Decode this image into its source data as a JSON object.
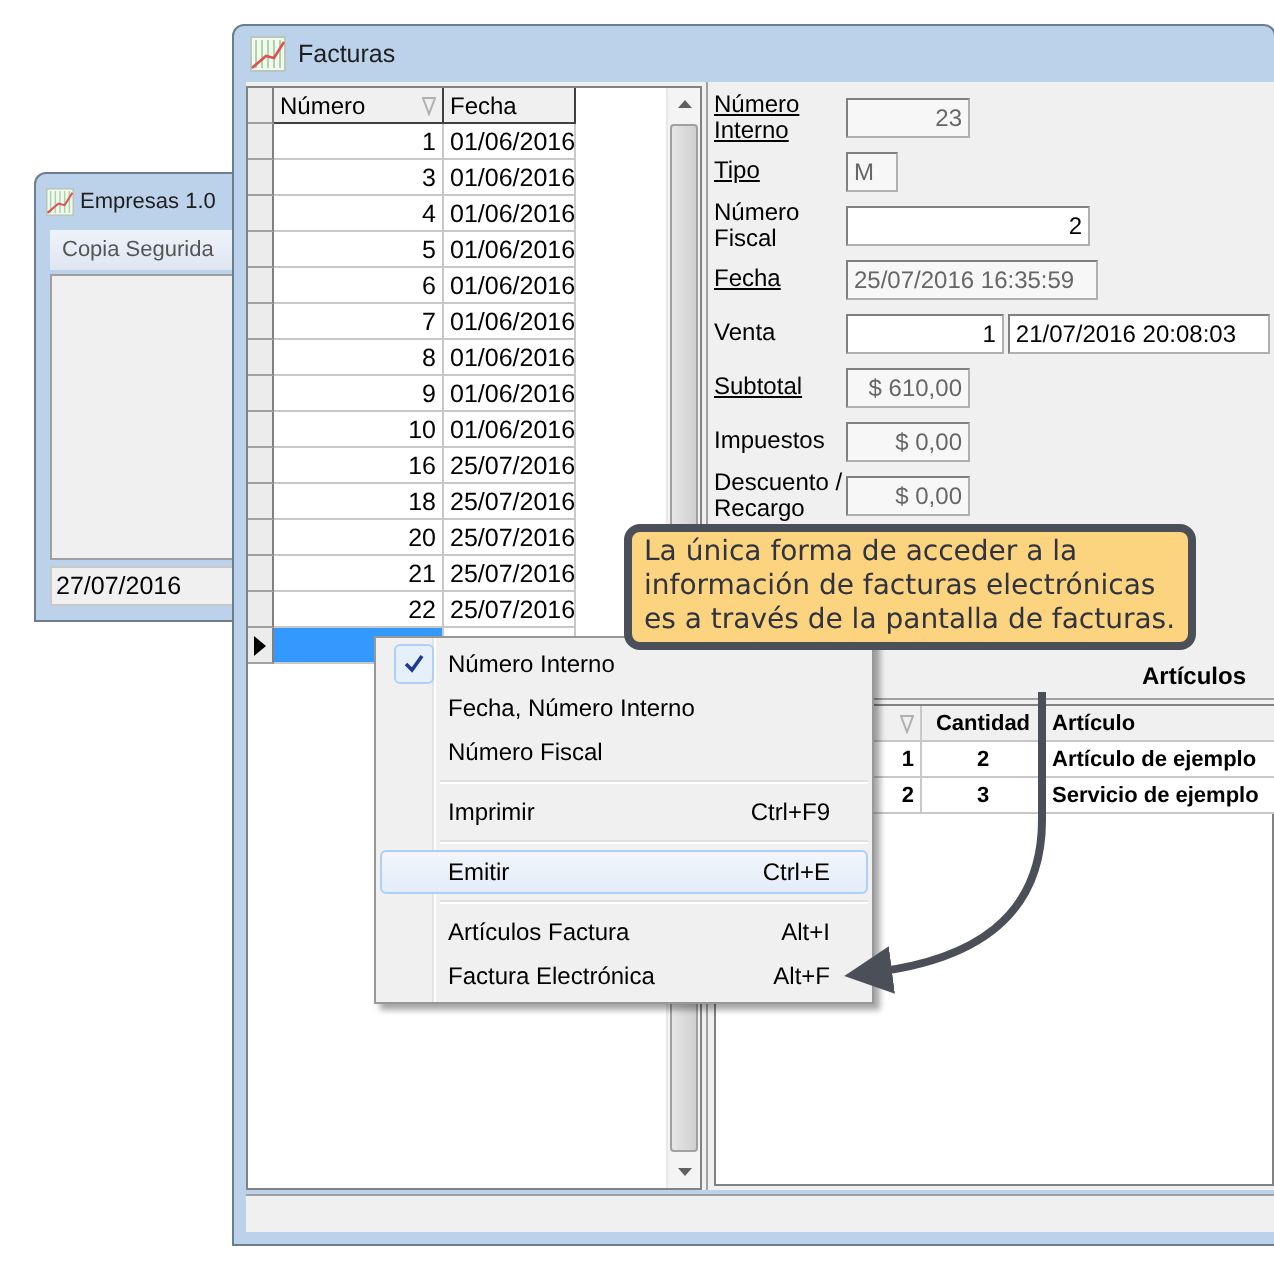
{
  "background_window": {
    "title": "Empresas 1.0",
    "menu": "Copia Segurida",
    "status": "27/07/2016"
  },
  "window": {
    "title": "Facturas"
  },
  "list": {
    "columns": [
      "Número",
      "Fecha"
    ],
    "rows": [
      {
        "numero": "1",
        "fecha": "01/06/2016",
        "selected": false
      },
      {
        "numero": "3",
        "fecha": "01/06/2016",
        "selected": false
      },
      {
        "numero": "4",
        "fecha": "01/06/2016",
        "selected": false
      },
      {
        "numero": "5",
        "fecha": "01/06/2016",
        "selected": false
      },
      {
        "numero": "6",
        "fecha": "01/06/2016",
        "selected": false
      },
      {
        "numero": "7",
        "fecha": "01/06/2016",
        "selected": false
      },
      {
        "numero": "8",
        "fecha": "01/06/2016",
        "selected": false
      },
      {
        "numero": "9",
        "fecha": "01/06/2016",
        "selected": false
      },
      {
        "numero": "10",
        "fecha": "01/06/2016",
        "selected": false
      },
      {
        "numero": "16",
        "fecha": "25/07/2016",
        "selected": false
      },
      {
        "numero": "18",
        "fecha": "25/07/2016",
        "selected": false
      },
      {
        "numero": "20",
        "fecha": "25/07/2016",
        "selected": false
      },
      {
        "numero": "21",
        "fecha": "25/07/2016",
        "selected": false
      },
      {
        "numero": "22",
        "fecha": "25/07/2016",
        "selected": false
      },
      {
        "selected": true
      }
    ]
  },
  "form": [
    {
      "kind": "number",
      "label": "Número Interno",
      "value": "23",
      "underlined": true,
      "disabled": true
    },
    {
      "kind": "code",
      "label": "Tipo",
      "value": "M",
      "underlined": true,
      "disabled": true
    },
    {
      "kind": "wide",
      "label": "Número Fiscal",
      "value": "2",
      "underlined": false,
      "disabled": false
    },
    {
      "kind": "date",
      "label": "Fecha",
      "value": "25/07/2016 16:35:59",
      "underlined": true,
      "disabled": true
    },
    {
      "kind": "pair",
      "label": "Venta",
      "value": "1",
      "value_2": "21/07/2016 20:08:03",
      "underlined": false,
      "disabled": false
    },
    {
      "kind": "number",
      "label": "Subtotal",
      "value": "$ 610,00",
      "underlined": true,
      "disabled": true
    },
    {
      "kind": "number",
      "label": "Impuestos",
      "value": "$ 0,00",
      "underlined": false,
      "disabled": true
    },
    {
      "kind": "number",
      "label": "Descuento / Recargo",
      "value": "$ 0,00",
      "underlined": false,
      "disabled": true
    }
  ],
  "articles": {
    "tab": "Artículos",
    "columns": [
      "",
      "Cantidad",
      "Artículo"
    ],
    "rows": [
      [
        "1",
        "2",
        "Artículo de ejemplo"
      ],
      [
        "2",
        "3",
        "Servicio de ejemplo"
      ]
    ]
  },
  "context_menu": [
    {
      "kind": "check",
      "label": "Número Interno",
      "checked": true
    },
    {
      "kind": "check",
      "label": "Fecha, Número Interno",
      "checked": false
    },
    {
      "kind": "check",
      "label": "Número Fiscal",
      "checked": false
    },
    {
      "kind": "separator"
    },
    {
      "kind": "item",
      "label": "Imprimir",
      "shortcut": "Ctrl+F9",
      "selected": false
    },
    {
      "kind": "separator"
    },
    {
      "kind": "item",
      "label": "Emitir",
      "shortcut": "Ctrl+E",
      "selected": true
    },
    {
      "kind": "separator"
    },
    {
      "kind": "item",
      "label": "Artículos Factura",
      "shortcut": "Alt+I",
      "selected": false
    },
    {
      "kind": "item",
      "label": "Factura Electrónica",
      "shortcut": "Alt+F",
      "selected": false
    }
  ],
  "callout": {
    "text": "La única forma de acceder a la información de facturas electrónicas es a través de la pantalla de facturas."
  }
}
